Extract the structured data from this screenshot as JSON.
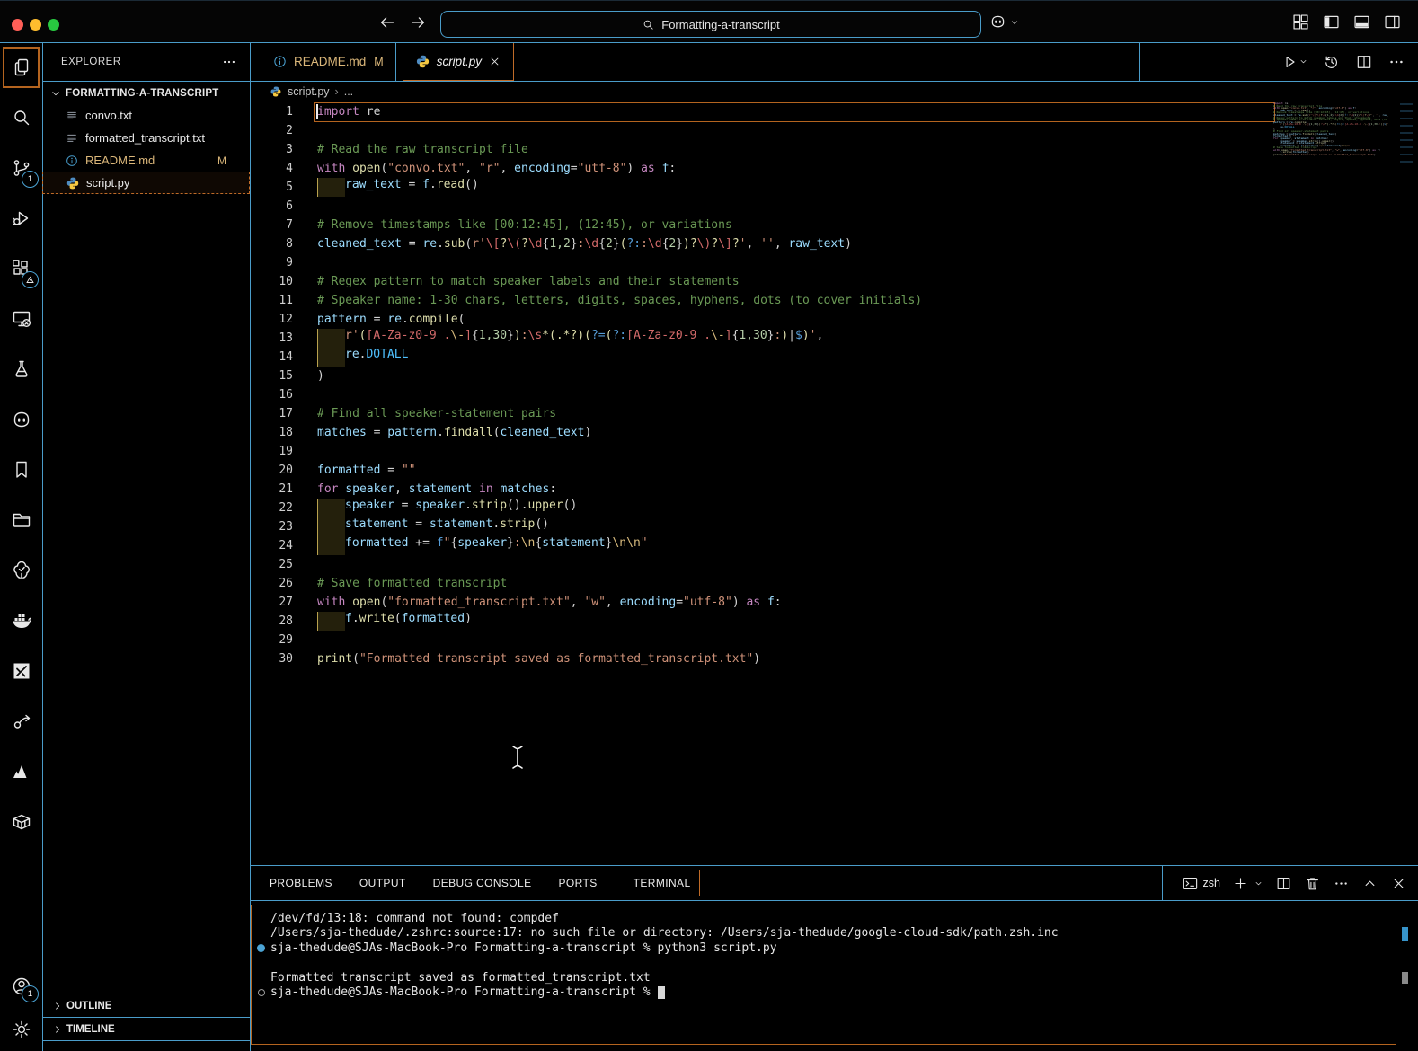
{
  "colors": {
    "border_blue": "#4a9cc9",
    "focus_orange": "#bf6b28",
    "traffic_red": "#ff5f57",
    "traffic_yellow": "#febc2e",
    "traffic_green": "#28c840",
    "badge_blue": "#4ba3d4",
    "modified_yellow": "#dbb77a"
  },
  "title_bar": {
    "search_value": "Formatting-a-transcript",
    "search_icon": "search-icon",
    "left_icons": [
      "arrow-left-icon",
      "arrow-right-icon"
    ],
    "copilot_icon": "copilot-icon",
    "copilot_chevron": "chevron-down-icon",
    "right_icons": [
      "customize-layout-icon",
      "layout-sidebar-left-icon",
      "layout-panel-icon",
      "layout-sidebar-right-icon"
    ]
  },
  "activity_bar": {
    "top_items": [
      {
        "name": "explorer",
        "icon": "files-icon",
        "active": true
      },
      {
        "name": "search",
        "icon": "search-icon"
      },
      {
        "name": "source-control",
        "icon": "source-control-icon",
        "badge": "1"
      },
      {
        "name": "run-and-debug",
        "icon": "run-debug-icon"
      },
      {
        "name": "extensions",
        "icon": "extensions-icon",
        "badge": "warn"
      },
      {
        "name": "remote-explorer",
        "icon": "remote-icon"
      },
      {
        "name": "testing",
        "icon": "flask-icon"
      },
      {
        "name": "copilot-chat",
        "icon": "chat-face-icon"
      },
      {
        "name": "bookmarks",
        "icon": "bookmark-icon"
      },
      {
        "name": "project-manager",
        "icon": "folder-icon"
      },
      {
        "name": "todo-tree",
        "icon": "tree-check-icon"
      },
      {
        "name": "docker",
        "icon": "docker-icon"
      },
      {
        "name": "drawio",
        "icon": "diagram-icon"
      },
      {
        "name": "live-share",
        "icon": "share-icon"
      },
      {
        "name": "atlassian",
        "icon": "mountain-icon"
      },
      {
        "name": "dev-containers",
        "icon": "container-icon"
      }
    ],
    "bottom_items": [
      {
        "name": "accounts",
        "icon": "account-icon",
        "badge": "1"
      },
      {
        "name": "settings",
        "icon": "gear-icon"
      }
    ]
  },
  "sidebar": {
    "header": "EXPLORER",
    "header_more_icon": "more-icon",
    "project": {
      "label": "FORMATTING-A-TRANSCRIPT",
      "chevron": "chevron-down-icon"
    },
    "files": [
      {
        "label": "convo.txt",
        "icon": "txt-file-icon"
      },
      {
        "label": "formatted_transcript.txt",
        "icon": "txt-file-icon"
      },
      {
        "label": "README.md",
        "icon": "info-icon",
        "modified": true,
        "badge": "M"
      },
      {
        "label": "script.py",
        "icon": "python-icon",
        "selected": true
      }
    ],
    "sections": [
      {
        "label": "OUTLINE",
        "chevron": "chevron-right-icon"
      },
      {
        "label": "TIMELINE",
        "chevron": "chevron-right-icon"
      }
    ]
  },
  "editor": {
    "tabs": [
      {
        "label": "README.md",
        "icon": "info-icon",
        "modified_badge": "M",
        "active": false
      },
      {
        "label": "script.py",
        "icon": "python-icon",
        "active": true,
        "close_icon": "close-icon"
      }
    ],
    "actions": [
      {
        "name": "run-python-file",
        "icon": "run-icon",
        "chevron": true
      },
      {
        "name": "timeline-history",
        "icon": "history-icon"
      },
      {
        "name": "split-editor",
        "icon": "split-editor-icon"
      },
      {
        "name": "more-actions",
        "icon": "more-icon"
      }
    ],
    "breadcrumb": {
      "icon": "python-icon",
      "file": "script.py",
      "more": "..."
    },
    "code_lines": [
      {
        "n": 1,
        "current": true,
        "tokens": [
          [
            "import",
            "kw"
          ],
          [
            " re",
            "op"
          ]
        ]
      },
      {
        "n": 2,
        "tokens": []
      },
      {
        "n": 3,
        "tokens": [
          [
            "# Read the raw transcript file",
            "cmt"
          ]
        ]
      },
      {
        "n": 4,
        "tokens": [
          [
            "with",
            "kw"
          ],
          [
            " ",
            "op"
          ],
          [
            "open",
            "fn"
          ],
          [
            "(",
            "op"
          ],
          [
            "\"convo.txt\"",
            "str"
          ],
          [
            ", ",
            "op"
          ],
          [
            "\"r\"",
            "str"
          ],
          [
            ", ",
            "op"
          ],
          [
            "encoding",
            "var"
          ],
          [
            "=",
            "op"
          ],
          [
            "\"utf-8\"",
            "str"
          ],
          [
            ")",
            "op"
          ],
          [
            " ",
            "op"
          ],
          [
            "as",
            "kw"
          ],
          [
            " ",
            "op"
          ],
          [
            "f",
            "var"
          ],
          [
            ":",
            "op"
          ]
        ]
      },
      {
        "n": 5,
        "ind": true,
        "tokens": [
          [
            "raw_text",
            "var"
          ],
          [
            " = ",
            "op"
          ],
          [
            "f",
            "var"
          ],
          [
            ".",
            "op"
          ],
          [
            "read",
            "fn"
          ],
          [
            "()",
            "op"
          ]
        ]
      },
      {
        "n": 6,
        "tokens": []
      },
      {
        "n": 7,
        "tokens": [
          [
            "# Remove timestamps like [00:12:45], (12:45), or variations",
            "cmt"
          ]
        ]
      },
      {
        "n": 8,
        "tokens": [
          [
            "cleaned_text",
            "var"
          ],
          [
            " = ",
            "op"
          ],
          [
            "re",
            "var"
          ],
          [
            ".",
            "op"
          ],
          [
            "sub",
            "fn"
          ],
          [
            "(",
            "op"
          ],
          [
            "r'",
            "str"
          ],
          [
            "\\[",
            "re1"
          ],
          [
            "?",
            "re2"
          ],
          [
            "\\(",
            "re1"
          ],
          [
            "?",
            "re2"
          ],
          [
            "\\d",
            "re1"
          ],
          [
            "{",
            "op"
          ],
          [
            "1,2",
            "num"
          ],
          [
            "}",
            "op"
          ],
          [
            ":",
            "str"
          ],
          [
            "\\d",
            "re1"
          ],
          [
            "{",
            "op"
          ],
          [
            "2",
            "num"
          ],
          [
            "}",
            "op"
          ],
          [
            "(",
            "re2"
          ],
          [
            "?:",
            "fstr"
          ],
          [
            ":",
            "str"
          ],
          [
            "\\d",
            "re1"
          ],
          [
            "{",
            "op"
          ],
          [
            "2",
            "num"
          ],
          [
            "}",
            "op"
          ],
          [
            ")",
            "re2"
          ],
          [
            "?",
            "re2"
          ],
          [
            "\\)",
            "re1"
          ],
          [
            "?",
            "re2"
          ],
          [
            "\\]",
            "re1"
          ],
          [
            "?",
            "re2"
          ],
          [
            "'",
            "str"
          ],
          [
            ", ",
            "op"
          ],
          [
            "''",
            "str"
          ],
          [
            ", ",
            "op"
          ],
          [
            "raw_text",
            "var"
          ],
          [
            ")",
            "op"
          ]
        ]
      },
      {
        "n": 9,
        "tokens": []
      },
      {
        "n": 10,
        "tokens": [
          [
            "# Regex pattern to match speaker labels and their statements",
            "cmt"
          ]
        ]
      },
      {
        "n": 11,
        "tokens": [
          [
            "# Speaker name: 1-30 chars, letters, digits, spaces, hyphens, dots (to cover initials)",
            "cmt"
          ]
        ]
      },
      {
        "n": 12,
        "tokens": [
          [
            "pattern",
            "var"
          ],
          [
            " = ",
            "op"
          ],
          [
            "re",
            "var"
          ],
          [
            ".",
            "op"
          ],
          [
            "compile",
            "fn"
          ],
          [
            "(",
            "op"
          ]
        ]
      },
      {
        "n": 13,
        "ind": true,
        "tokens": [
          [
            "r'",
            "str"
          ],
          [
            "(",
            "re2"
          ],
          [
            "[",
            "re1"
          ],
          [
            "A-Za-z0-9 .",
            "re1"
          ],
          [
            "\\-",
            "esc"
          ],
          [
            "]",
            "re1"
          ],
          [
            "{",
            "op"
          ],
          [
            "1,30",
            "num"
          ],
          [
            "}",
            "op"
          ],
          [
            ")",
            "re2"
          ],
          [
            ":",
            "str"
          ],
          [
            "\\s",
            "re1"
          ],
          [
            "*",
            "re2"
          ],
          [
            "(",
            "re2"
          ],
          [
            ".*?",
            "re2"
          ],
          [
            ")",
            "re2"
          ],
          [
            "(",
            "re2"
          ],
          [
            "?=",
            "fstr"
          ],
          [
            "(",
            "re2"
          ],
          [
            "?:",
            "fstr"
          ],
          [
            "[",
            "re1"
          ],
          [
            "A-Za-z0-9 .",
            "re1"
          ],
          [
            "\\-",
            "esc"
          ],
          [
            "]",
            "re1"
          ],
          [
            "{",
            "op"
          ],
          [
            "1,30",
            "num"
          ],
          [
            "}",
            "op"
          ],
          [
            ":",
            "str"
          ],
          [
            ")",
            "re2"
          ],
          [
            "|",
            "op"
          ],
          [
            "$",
            "fstr"
          ],
          [
            ")",
            "re2"
          ],
          [
            "'",
            "str"
          ],
          [
            ",",
            "op"
          ]
        ]
      },
      {
        "n": 14,
        "ind": true,
        "tokens": [
          [
            "re",
            "var"
          ],
          [
            ".",
            "op"
          ],
          [
            "DOTALL",
            "const"
          ]
        ]
      },
      {
        "n": 15,
        "tokens": [
          [
            ")",
            "op"
          ]
        ]
      },
      {
        "n": 16,
        "tokens": []
      },
      {
        "n": 17,
        "tokens": [
          [
            "# Find all speaker-statement pairs",
            "cmt"
          ]
        ]
      },
      {
        "n": 18,
        "tokens": [
          [
            "matches",
            "var"
          ],
          [
            " = ",
            "op"
          ],
          [
            "pattern",
            "var"
          ],
          [
            ".",
            "op"
          ],
          [
            "findall",
            "fn"
          ],
          [
            "(",
            "op"
          ],
          [
            "cleaned_text",
            "var"
          ],
          [
            ")",
            "op"
          ]
        ]
      },
      {
        "n": 19,
        "tokens": []
      },
      {
        "n": 20,
        "tokens": [
          [
            "formatted",
            "var"
          ],
          [
            " = ",
            "op"
          ],
          [
            "\"\"",
            "str"
          ]
        ]
      },
      {
        "n": 21,
        "tokens": [
          [
            "for",
            "kw"
          ],
          [
            " ",
            "op"
          ],
          [
            "speaker",
            "var"
          ],
          [
            ", ",
            "op"
          ],
          [
            "statement",
            "var"
          ],
          [
            " ",
            "op"
          ],
          [
            "in",
            "kw"
          ],
          [
            " ",
            "op"
          ],
          [
            "matches",
            "var"
          ],
          [
            ":",
            "op"
          ]
        ]
      },
      {
        "n": 22,
        "ind": true,
        "tokens": [
          [
            "speaker",
            "var"
          ],
          [
            " = ",
            "op"
          ],
          [
            "speaker",
            "var"
          ],
          [
            ".",
            "op"
          ],
          [
            "strip",
            "fn"
          ],
          [
            "()",
            "op"
          ],
          [
            ".",
            "op"
          ],
          [
            "upper",
            "fn"
          ],
          [
            "()",
            "op"
          ]
        ]
      },
      {
        "n": 23,
        "ind": true,
        "tokens": [
          [
            "statement",
            "var"
          ],
          [
            " = ",
            "op"
          ],
          [
            "statement",
            "var"
          ],
          [
            ".",
            "op"
          ],
          [
            "strip",
            "fn"
          ],
          [
            "()",
            "op"
          ]
        ]
      },
      {
        "n": 24,
        "ind": true,
        "tokens": [
          [
            "formatted",
            "var"
          ],
          [
            " += ",
            "op"
          ],
          [
            "f",
            "fstr"
          ],
          [
            "\"",
            "str"
          ],
          [
            "{",
            "op"
          ],
          [
            "speaker",
            "var"
          ],
          [
            "}",
            "op"
          ],
          [
            ":",
            "str"
          ],
          [
            "\\n",
            "esc"
          ],
          [
            "{",
            "op"
          ],
          [
            "statement",
            "var"
          ],
          [
            "}",
            "op"
          ],
          [
            "\\n\\n",
            "esc"
          ],
          [
            "\"",
            "str"
          ]
        ]
      },
      {
        "n": 25,
        "tokens": []
      },
      {
        "n": 26,
        "tokens": [
          [
            "# Save formatted transcript",
            "cmt"
          ]
        ]
      },
      {
        "n": 27,
        "tokens": [
          [
            "with",
            "kw"
          ],
          [
            " ",
            "op"
          ],
          [
            "open",
            "fn"
          ],
          [
            "(",
            "op"
          ],
          [
            "\"formatted_transcript.txt\"",
            "str"
          ],
          [
            ", ",
            "op"
          ],
          [
            "\"w\"",
            "str"
          ],
          [
            ", ",
            "op"
          ],
          [
            "encoding",
            "var"
          ],
          [
            "=",
            "op"
          ],
          [
            "\"utf-8\"",
            "str"
          ],
          [
            ")",
            "op"
          ],
          [
            " ",
            "op"
          ],
          [
            "as",
            "kw"
          ],
          [
            " ",
            "op"
          ],
          [
            "f",
            "var"
          ],
          [
            ":",
            "op"
          ]
        ]
      },
      {
        "n": 28,
        "ind": true,
        "tokens": [
          [
            "f",
            "var"
          ],
          [
            ".",
            "op"
          ],
          [
            "write",
            "fn"
          ],
          [
            "(",
            "op"
          ],
          [
            "formatted",
            "var"
          ],
          [
            ")",
            "op"
          ]
        ]
      },
      {
        "n": 29,
        "tokens": []
      },
      {
        "n": 30,
        "tokens": [
          [
            "print",
            "fn"
          ],
          [
            "(",
            "op"
          ],
          [
            "\"Formatted transcript saved as formatted_transcript.txt\"",
            "str"
          ],
          [
            ")",
            "op"
          ]
        ]
      }
    ]
  },
  "panel": {
    "tabs": [
      "PROBLEMS",
      "OUTPUT",
      "DEBUG CONSOLE",
      "PORTS",
      "TERMINAL"
    ],
    "active_tab": "TERMINAL",
    "actions": [
      {
        "name": "shell-select",
        "icon": "terminal-icon",
        "label": "zsh"
      },
      {
        "name": "new-terminal",
        "icon": "plus-icon",
        "chevron": true
      },
      {
        "name": "split-terminal",
        "icon": "split-editor-icon"
      },
      {
        "name": "kill-terminal",
        "icon": "trash-icon"
      },
      {
        "name": "more-actions",
        "icon": "more-icon"
      },
      {
        "name": "maximize-panel",
        "icon": "chevron-up-icon"
      },
      {
        "name": "close-panel",
        "icon": "close-icon"
      }
    ],
    "terminal_lines": [
      {
        "gutter": null,
        "text": "/dev/fd/13:18: command not found: compdef"
      },
      {
        "gutter": null,
        "text": "/Users/sja-thedude/.zshrc:source:17: no such file or directory: /Users/sja-thedude/google-cloud-sdk/path.zsh.inc"
      },
      {
        "gutter": "filled",
        "text": "sja-thedude@SJAs-MacBook-Pro Formatting-a-transcript % python3 script.py"
      },
      {
        "gutter": null,
        "text": ""
      },
      {
        "gutter": null,
        "text": "Formatted transcript saved as formatted_transcript.txt"
      },
      {
        "gutter": "hollow",
        "text": "sja-thedude@SJAs-MacBook-Pro Formatting-a-transcript % ",
        "cursor": true
      }
    ]
  }
}
